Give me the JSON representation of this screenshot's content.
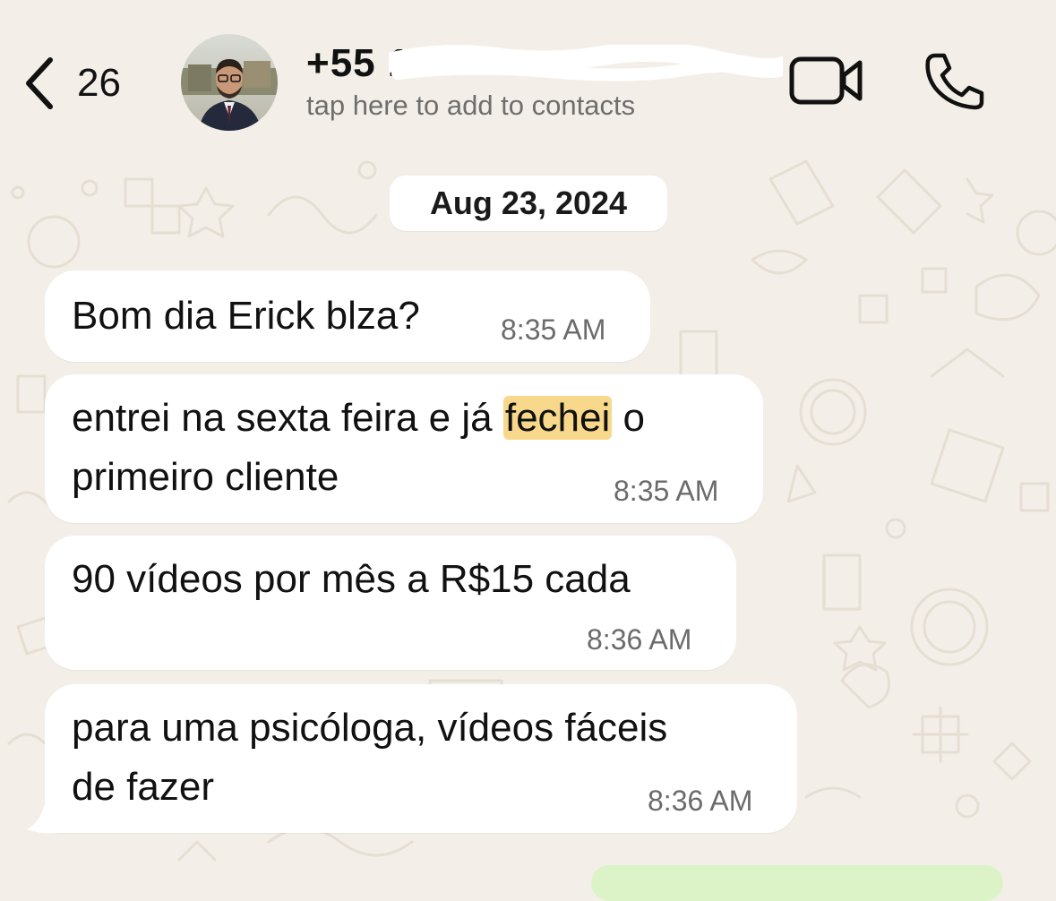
{
  "header": {
    "back_count": "26",
    "contact_name": "+55 12",
    "contact_subtitle": "tap here to add to contacts"
  },
  "chat": {
    "date_separator": "Aug 23, 2024",
    "messages": [
      {
        "text": "Bom dia Erick blza?",
        "time": "8:35 AM"
      },
      {
        "text_before": "entrei na sexta feira e já ",
        "highlight": "fechei",
        "text_after": " o",
        "line2": "primeiro cliente",
        "time": "8:35 AM"
      },
      {
        "text": "90 vídeos por mês a R$15 cada",
        "time": "8:36 AM"
      },
      {
        "line1": "para uma psicóloga, vídeos fáceis",
        "line2": "de fazer",
        "time": "8:36 AM"
      }
    ]
  },
  "colors": {
    "wallpaper": "#f3efe8",
    "bubble": "#ffffff",
    "highlight": "#f8d88a",
    "outgoing_bubble": "#dcf3c8"
  },
  "icons": [
    "chevron-left-icon",
    "video-camera-icon",
    "phone-icon"
  ]
}
